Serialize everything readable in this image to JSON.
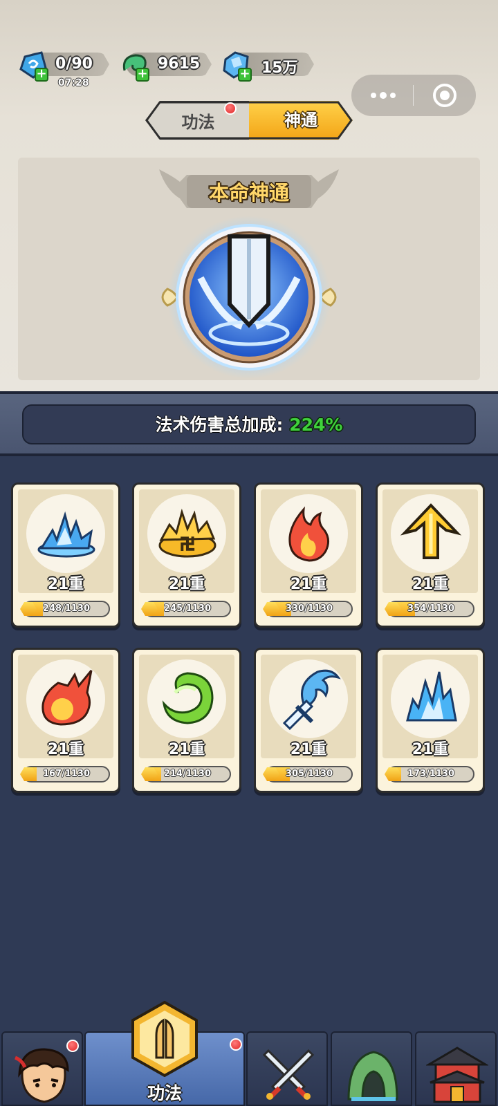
{
  "resources": {
    "stamina": {
      "value": "0/90",
      "timer": "07:28",
      "icon": "spirit-stone-icon"
    },
    "jade": {
      "value": "9615",
      "icon": "jade-dragon-icon"
    },
    "crystal": {
      "value": "15万",
      "icon": "crystal-icon"
    }
  },
  "tabs": [
    {
      "label": "功法",
      "active": false,
      "has_dot": true
    },
    {
      "label": "神通",
      "active": true,
      "has_dot": false
    }
  ],
  "main_skill": {
    "title": "本命神通",
    "icon": "sword-icon"
  },
  "bonus": {
    "label": "法术伤害总加成:",
    "value": "224%"
  },
  "cards": [
    {
      "icon": "ice-burst-icon",
      "level": "21重",
      "progress_text": "248/1130",
      "progress": 0.22
    },
    {
      "icon": "golden-burst-icon",
      "level": "21重",
      "progress_text": "245/1130",
      "progress": 0.22
    },
    {
      "icon": "flame-icon",
      "level": "21重",
      "progress_text": "330/1130",
      "progress": 0.29
    },
    {
      "icon": "golden-arrow-icon",
      "level": "21重",
      "progress_text": "354/1130",
      "progress": 0.31
    },
    {
      "icon": "fireball-icon",
      "level": "21重",
      "progress_text": "167/1130",
      "progress": 0.15
    },
    {
      "icon": "wind-swirl-icon",
      "level": "21重",
      "progress_text": "214/1130",
      "progress": 0.19
    },
    {
      "icon": "ice-sword-icon",
      "level": "21重",
      "progress_text": "305/1130",
      "progress": 0.27
    },
    {
      "icon": "blue-flame-icon",
      "level": "21重",
      "progress_text": "173/1130",
      "progress": 0.15
    }
  ],
  "bottom_nav": [
    {
      "icon": "hero-avatar-icon",
      "label": "",
      "active": false,
      "has_dot": true
    },
    {
      "icon": "praying-hands-icon",
      "label": "功法",
      "active": true,
      "has_dot": true
    },
    {
      "icon": "crossed-swords-icon",
      "label": "",
      "active": false,
      "has_dot": false
    },
    {
      "icon": "cave-icon",
      "label": "",
      "active": false,
      "has_dot": false
    },
    {
      "icon": "temple-icon",
      "label": "",
      "active": false,
      "has_dot": false
    }
  ],
  "colors": {
    "accent_gold": "#f3a416",
    "bonus_green": "#3fd13c",
    "panel_navy": "#2f3a55"
  }
}
